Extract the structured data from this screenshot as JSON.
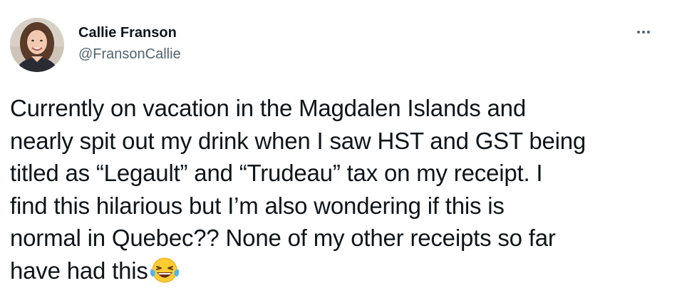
{
  "tweet": {
    "author": {
      "display_name": "Callie Franson",
      "handle": "@FransonCallie"
    },
    "more_icon": "more-horizontal-icon",
    "text_lines": [
      "Currently on vacation in the Magdalen Islands and",
      "nearly spit out my drink when I saw HST and GST being",
      "titled as “Legault” and “Trudeau” tax on my receipt. I",
      "find this hilarious but I’m also wondering if this is",
      "normal in Quebec?? None of my other receipts so far",
      "have had this"
    ],
    "emoji": "face-with-tears-of-joy-emoji"
  },
  "colors": {
    "text": "#0f1419",
    "secondary_text": "#536471",
    "background": "#ffffff"
  }
}
